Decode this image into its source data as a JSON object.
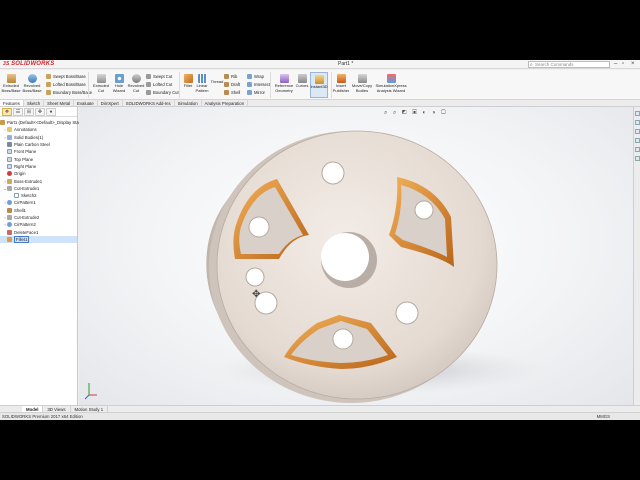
{
  "window": {
    "app_logo": "SOLIDWORKS",
    "doc_title": "Part1 *",
    "search_placeholder": "Search Commands"
  },
  "ribbon": {
    "big": [
      "Extruded Boss/Base",
      "Revolved Boss/Base",
      "Extruded Cut",
      "Hole Wizard",
      "Revolved Cut",
      "Fillet",
      "Linear Pattern",
      "Rib",
      "Wrap",
      "Reference Geometry",
      "Curves",
      "Instant3D",
      "Insert Publisher",
      "Move/Copy Bodies",
      "SimulationXpress Analysis Wizard"
    ],
    "small_boss": [
      "Swept Boss/Base",
      "Lofted Boss/Base",
      "Boundary Boss/Base"
    ],
    "small_cut": [
      "Swept Cut",
      "Lofted Cut",
      "Boundary Cut"
    ],
    "small_misc": [
      "Draft",
      "Shell",
      "Intersect",
      "Mirror"
    ],
    "thread": "Thread"
  },
  "command_tabs": [
    "Features",
    "Sketch",
    "Sheet Metal",
    "Evaluate",
    "DimXpert",
    "SOLIDWORKS Add-Ins",
    "Simulation",
    "Analysis Preparation"
  ],
  "tree": {
    "root": "Part1 (Default<<Default>_Display State",
    "items": [
      "Annotations",
      "Solid Bodies(1)",
      "Plain Carbon Steel",
      "Front Plane",
      "Top Plane",
      "Right Plane",
      "Origin",
      "Boss-Extrude1",
      "Cut-Extrude1",
      "Sketch2",
      "CirPattern1",
      "Shell1",
      "Cut-Extrude2",
      "CirPattern2",
      "DeleteFace1",
      "Fillet1"
    ]
  },
  "bottom_tabs": [
    "Model",
    "3D Views",
    "Motion Study 1"
  ],
  "status": {
    "left": "SOLIDWORKS Premium 2017 x64 Edition",
    "right": "MMGS"
  },
  "colors": {
    "part_face": "#e6ddd6",
    "fillet": "#d98a2c",
    "logo_red": "#d2232a"
  }
}
